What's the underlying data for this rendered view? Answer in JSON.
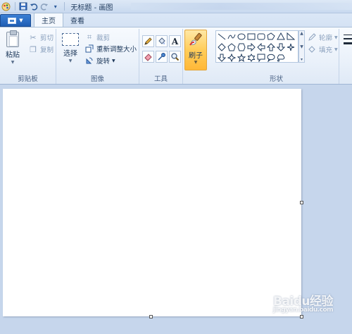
{
  "window": {
    "title": "无标题 - 画图"
  },
  "tabs": [
    {
      "label": "主页"
    },
    {
      "label": "查看"
    }
  ],
  "clipboard": {
    "paste": "粘贴",
    "cut": "剪切",
    "copy": "复制",
    "group": "剪贴板"
  },
  "image": {
    "select": "选择",
    "crop": "裁剪",
    "resize": "重新调整大小",
    "rotate": "旋转",
    "group": "图像"
  },
  "tools": {
    "group": "工具",
    "text_glyph": "A"
  },
  "brushes": {
    "label": "刷子"
  },
  "shapes": {
    "outline": "轮廓",
    "fill": "填充",
    "group": "形状"
  },
  "watermark": {
    "text": "Baidu经验",
    "sub": "jingyan.baidu.com"
  },
  "colors": {
    "accent": "#1f5fb5",
    "brush_active": "#ffcd5a",
    "canvas": "#ffffff",
    "workspace": "#c6d6ec"
  }
}
